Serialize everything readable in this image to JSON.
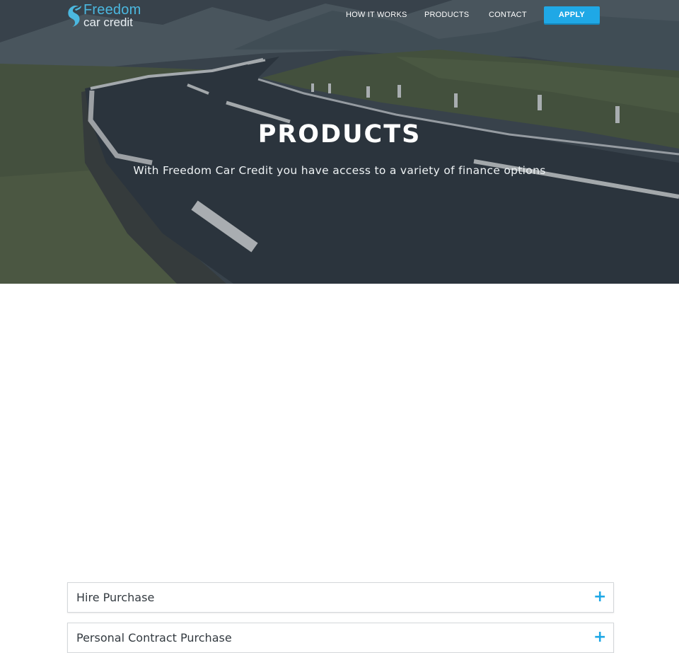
{
  "brand": {
    "line1": "Freedom",
    "line2": "car credit",
    "accent_color": "#4bb8e0"
  },
  "nav": {
    "links": [
      {
        "label": "HOW IT WORKS"
      },
      {
        "label": "PRODUCTS"
      },
      {
        "label": "CONTACT"
      }
    ],
    "apply_label": "APPLY",
    "apply_color": "#1fa8e6"
  },
  "hero": {
    "title": "PRODUCTS",
    "subtitle": "With Freedom Car Credit you have access to a variety of finance options",
    "background": "road-landscape-photo"
  },
  "accordion": {
    "items": [
      {
        "label": "Hire Purchase",
        "icon": "plus-icon"
      },
      {
        "label": "Personal Contract Purchase",
        "icon": "plus-icon"
      }
    ]
  }
}
